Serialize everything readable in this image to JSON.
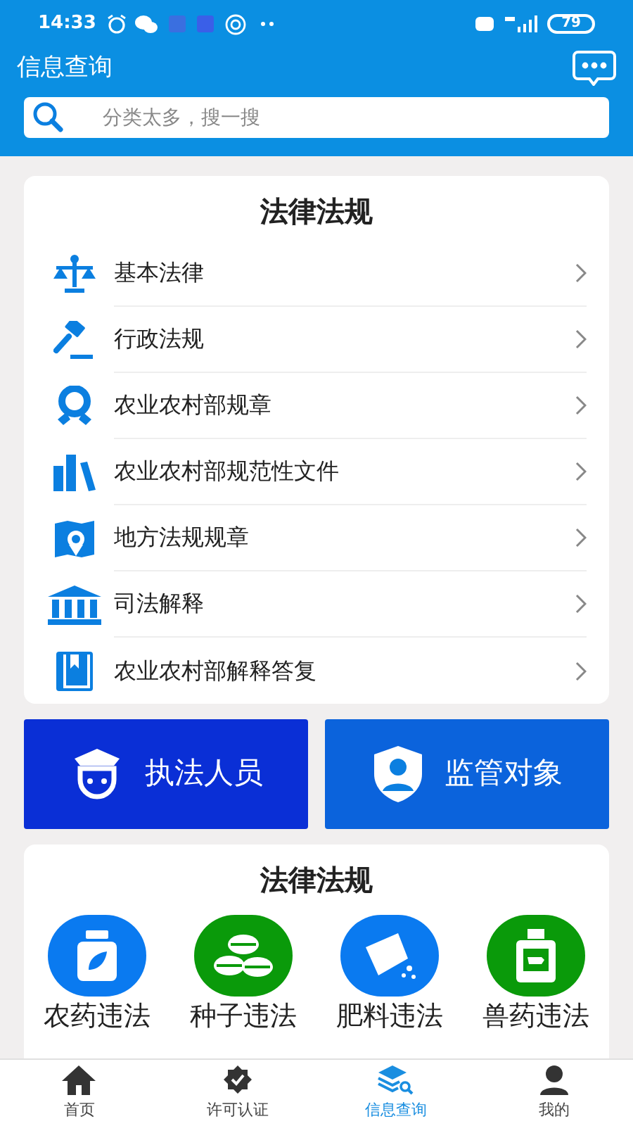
{
  "status_bar": {
    "time": "14:33",
    "battery": "79"
  },
  "header": {
    "title": "信息查询"
  },
  "search": {
    "placeholder": "分类太多，搜一搜"
  },
  "laws": {
    "title": "法律法规",
    "items": [
      {
        "label": "基本法律"
      },
      {
        "label": "行政法规"
      },
      {
        "label": "农业农村部规章"
      },
      {
        "label": "农业农村部规范性文件"
      },
      {
        "label": "地方法规规章"
      },
      {
        "label": "司法解释"
      },
      {
        "label": "农业农村部解释答复"
      }
    ]
  },
  "banners": [
    {
      "label": "执法人员",
      "color": "#0a2fd6"
    },
    {
      "label": "监管对象",
      "color": "#0b63dc"
    }
  ],
  "violations": {
    "title": "法律法规",
    "items": [
      {
        "label": "农药违法",
        "color": "#0a7af0"
      },
      {
        "label": "种子违法",
        "color": "#0a9a0a"
      },
      {
        "label": "肥料违法",
        "color": "#0a7af0"
      },
      {
        "label": "兽药违法",
        "color": "#0a9a0a"
      }
    ]
  },
  "nav": [
    {
      "label": "首页",
      "selected": false
    },
    {
      "label": "许可认证",
      "selected": false
    },
    {
      "label": "信息查询",
      "selected": true
    },
    {
      "label": "我的",
      "selected": false
    }
  ]
}
